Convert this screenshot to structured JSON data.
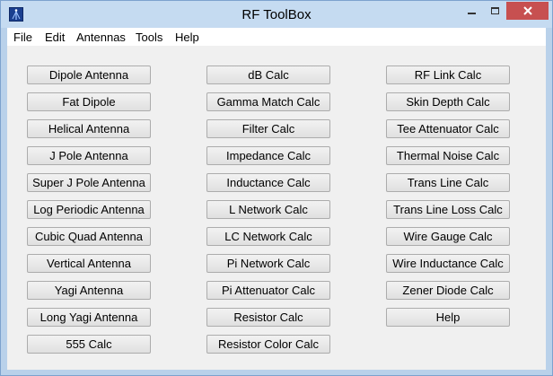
{
  "window": {
    "title": "RF ToolBox"
  },
  "menu": [
    "File",
    "Edit",
    "Antennas",
    "Tools",
    "Help"
  ],
  "columns": [
    [
      "Dipole Antenna",
      "Fat Dipole",
      "Helical Antenna",
      "J Pole Antenna",
      "Super J Pole Antenna",
      "Log Periodic Antenna",
      "Cubic Quad Antenna",
      "Vertical Antenna",
      "Yagi Antenna",
      "Long Yagi Antenna",
      "555 Calc"
    ],
    [
      "dB Calc",
      "Gamma Match Calc",
      "Filter Calc",
      "Impedance Calc",
      "Inductance Calc",
      "L Network Calc",
      "LC Network Calc",
      "Pi Network Calc",
      "Pi Attenuator Calc",
      "Resistor Calc",
      "Resistor Color Calc"
    ],
    [
      "RF Link Calc",
      "Skin Depth Calc",
      "Tee Attenuator Calc",
      "Thermal Noise Calc",
      "Trans Line Calc",
      "Trans Line Loss Calc",
      "Wire Gauge Calc",
      "Wire Inductance Calc",
      "Zener Diode Calc",
      "Help"
    ]
  ],
  "icons": {
    "app": "antenna-app-icon",
    "minimize": "minimize-icon",
    "maximize": "maximize-icon",
    "close": "close-icon"
  },
  "colors": {
    "titlebar": "#c5dbf1",
    "close_button": "#c75050",
    "client": "#f0f0f0"
  }
}
